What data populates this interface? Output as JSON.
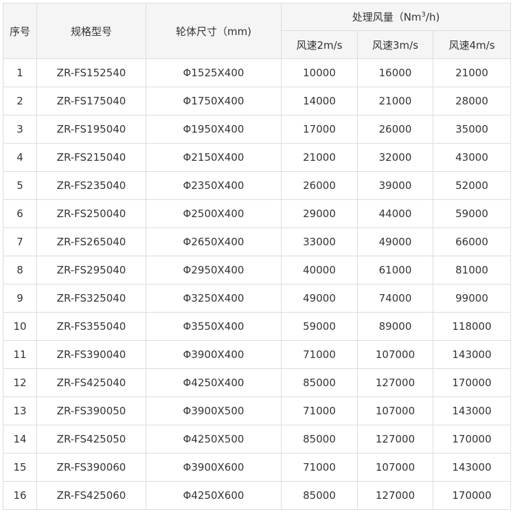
{
  "headers": {
    "no": "序号",
    "model": "规格型号",
    "size": "轮体尺寸（mm)",
    "airflow_prefix": "处理风量（Nm",
    "airflow_sup": "3",
    "airflow_suffix": "/h)",
    "speed1": "风速2m/s",
    "speed2": "风速3m/s",
    "speed3": "风速4m/s"
  },
  "rows": [
    {
      "no": "1",
      "model": "ZR-FS152540",
      "size": "Φ1525X400",
      "v1": "10000",
      "v2": "16000",
      "v3": "21000"
    },
    {
      "no": "2",
      "model": "ZR-FS175040",
      "size": "Φ1750X400",
      "v1": "14000",
      "v2": "21000",
      "v3": "28000"
    },
    {
      "no": "3",
      "model": "ZR-FS195040",
      "size": "Φ1950X400",
      "v1": "17000",
      "v2": "26000",
      "v3": "35000"
    },
    {
      "no": "4",
      "model": "ZR-FS215040",
      "size": "Φ2150X400",
      "v1": "21000",
      "v2": "32000",
      "v3": "43000"
    },
    {
      "no": "5",
      "model": "ZR-FS235040",
      "size": "Φ2350X400",
      "v1": "26000",
      "v2": "39000",
      "v3": "52000"
    },
    {
      "no": "6",
      "model": "ZR-FS250040",
      "size": "Φ2500X400",
      "v1": "29000",
      "v2": "44000",
      "v3": "59000"
    },
    {
      "no": "7",
      "model": "ZR-FS265040",
      "size": "Φ2650X400",
      "v1": "33000",
      "v2": "49000",
      "v3": "66000"
    },
    {
      "no": "8",
      "model": "ZR-FS295040",
      "size": "Φ2950X400",
      "v1": "40000",
      "v2": "61000",
      "v3": "81000"
    },
    {
      "no": "9",
      "model": "ZR-FS325040",
      "size": "Φ3250X400",
      "v1": "49000",
      "v2": "74000",
      "v3": "99000"
    },
    {
      "no": "10",
      "model": "ZR-FS355040",
      "size": "Φ3550X400",
      "v1": "59000",
      "v2": "89000",
      "v3": "118000"
    },
    {
      "no": "11",
      "model": "ZR-FS390040",
      "size": "Φ3900X400",
      "v1": "71000",
      "v2": "107000",
      "v3": "143000"
    },
    {
      "no": "12",
      "model": "ZR-FS425040",
      "size": "Φ4250X400",
      "v1": "85000",
      "v2": "127000",
      "v3": "170000"
    },
    {
      "no": "13",
      "model": "ZR-FS390050",
      "size": "Φ3900X500",
      "v1": "71000",
      "v2": "107000",
      "v3": "143000"
    },
    {
      "no": "14",
      "model": "ZR-FS425050",
      "size": "Φ4250X500",
      "v1": "85000",
      "v2": "127000",
      "v3": "170000"
    },
    {
      "no": "15",
      "model": "ZR-FS390060",
      "size": "Φ3900X600",
      "v1": "71000",
      "v2": "107000",
      "v3": "143000"
    },
    {
      "no": "16",
      "model": "ZR-FS425060",
      "size": "Φ4250X600",
      "v1": "85000",
      "v2": "127000",
      "v3": "170000"
    }
  ]
}
